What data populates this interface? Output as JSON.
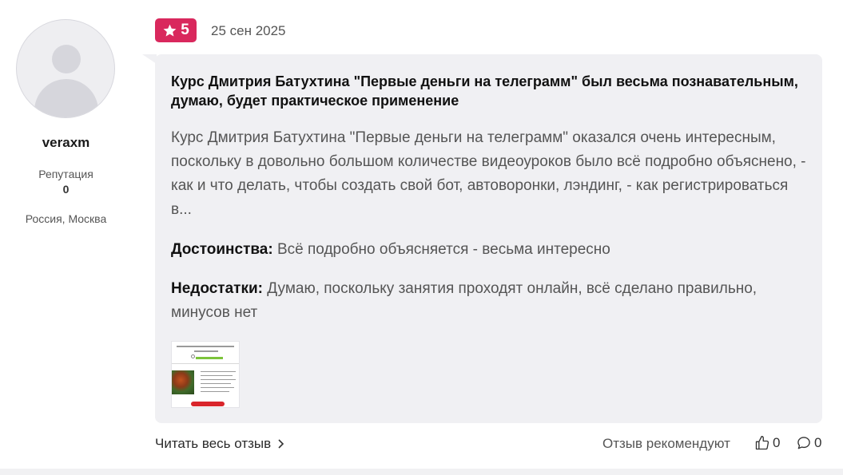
{
  "author": {
    "username": "veraxm",
    "reputation_label": "Репутация",
    "reputation_value": "0",
    "location": "Россия, Москва"
  },
  "review": {
    "rating": "5",
    "date": "25 сен 2025",
    "title": "Курс Дмитрия Батухтина \"Первые деньги на телеграмм\" был весьма познавательным, думаю, будет практическое применение",
    "text": "Курс Дмитрия Батухтина \"Первые деньги на телеграмм\" оказался очень интересным, поскольку в довольно большом количестве видеоуроков было всё подробно объяснено, - как и что делать, чтобы создать свой бот, автоворонки, лэндинг, - как регистрироваться в...",
    "pros_label": "Достоинства:",
    "pros_text": " Всё подробно объясняется - весьма интересно",
    "cons_label": "Недостатки:",
    "cons_text": " Думаю, поскольку занятия проходят онлайн, всё сделано правильно, минусов нет",
    "thumbnail_icon": "review-photo"
  },
  "footer": {
    "read_more": "Читать весь отзыв",
    "recommend": "Отзыв рекомендуют",
    "likes": "0",
    "comments": "0"
  },
  "colors": {
    "rating_badge": "#d9285d",
    "bubble": "#f0f0f3"
  }
}
